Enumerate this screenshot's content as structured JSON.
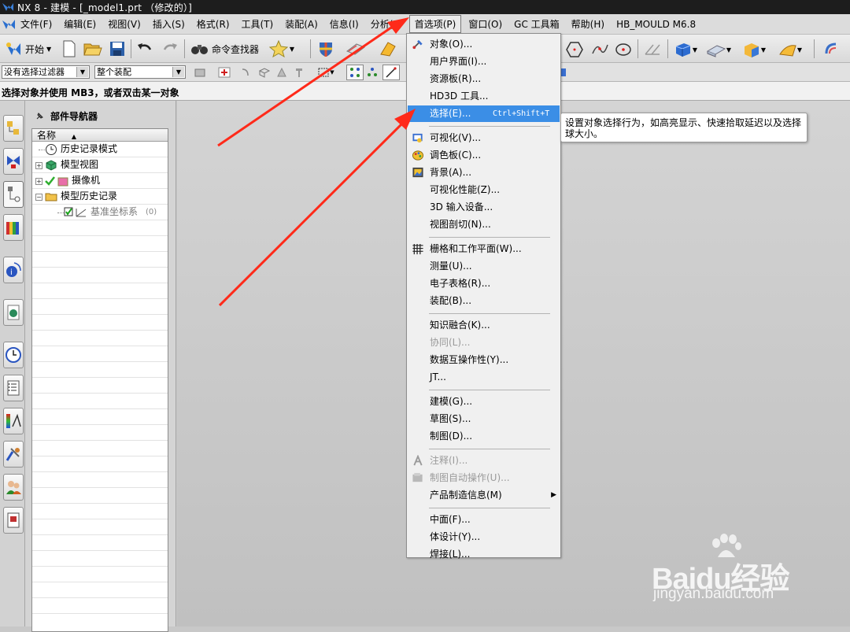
{
  "window": {
    "title": "NX 8 - 建模 - [_model1.prt （修改的）]"
  },
  "menubar": {
    "items": [
      "文件(F)",
      "编辑(E)",
      "视图(V)",
      "插入(S)",
      "格式(R)",
      "工具(T)",
      "装配(A)",
      "信息(I)",
      "分析(L)",
      "首选项(P)",
      "窗口(O)",
      "GC 工具箱",
      "帮助(H)",
      "HB_MOULD M6.8"
    ],
    "active_index": 9
  },
  "toolbar": {
    "start_label": "开始",
    "command_finder_label": "命令查找器"
  },
  "selection_bar": {
    "filter_value": "没有选择过滤器",
    "scope_value": "整个装配"
  },
  "status": {
    "prompt": "选择对象并使用 MB3，或者双击某一对象"
  },
  "navigator": {
    "title": "部件导航器",
    "column_header": "名称",
    "rows": [
      {
        "label": "历史记录模式",
        "icon": "clock-icon",
        "expander": "",
        "indent": 1
      },
      {
        "label": "模型视图",
        "icon": "model-views-icon",
        "expander": "+",
        "indent": 1
      },
      {
        "label": "摄像机",
        "icon": "camera-icon",
        "expander": "+",
        "indent": 1
      },
      {
        "label": "模型历史记录",
        "icon": "folder-icon",
        "expander": "-",
        "indent": 1
      },
      {
        "label": "基准坐标系",
        "icon": "datum-csys-icon",
        "expander": "",
        "indent": 2,
        "suffix": "(0)"
      }
    ]
  },
  "preferences_menu": {
    "items": [
      {
        "label": "对象(O)...",
        "icon": "object-icon"
      },
      {
        "label": "用户界面(I)...",
        "icon": ""
      },
      {
        "label": "资源板(R)...",
        "icon": ""
      },
      {
        "label": "HD3D 工具...",
        "icon": ""
      },
      {
        "label": "选择(E)...",
        "icon": "",
        "shortcut": "Ctrl+Shift+T",
        "highlighted": true
      },
      {
        "label": "可视化(V)...",
        "icon": "visualization-icon"
      },
      {
        "label": "调色板(C)...",
        "icon": "palette-icon"
      },
      {
        "label": "背景(A)...",
        "icon": "background-icon"
      },
      {
        "label": "可视化性能(Z)...",
        "icon": ""
      },
      {
        "label": "3D 输入设备...",
        "icon": ""
      },
      {
        "label": "视图剖切(N)...",
        "icon": ""
      },
      {
        "label": "栅格和工作平面(W)...",
        "icon": "grid-icon"
      },
      {
        "label": "测量(U)...",
        "icon": ""
      },
      {
        "label": "电子表格(R)...",
        "icon": ""
      },
      {
        "label": "装配(B)...",
        "icon": ""
      },
      {
        "label": "知识融合(K)...",
        "icon": ""
      },
      {
        "label": "协同(L)...",
        "icon": "",
        "disabled": true
      },
      {
        "label": "数据互操作性(Y)...",
        "icon": ""
      },
      {
        "label": "JT...",
        "icon": ""
      },
      {
        "label": "建模(G)...",
        "icon": ""
      },
      {
        "label": "草图(S)...",
        "icon": ""
      },
      {
        "label": "制图(D)...",
        "icon": ""
      },
      {
        "label": "注释(I)...",
        "icon": "annotation-icon",
        "disabled": true
      },
      {
        "label": "制图自动操作(U)...",
        "icon": "drafting-automation-icon",
        "disabled": true
      },
      {
        "label": "产品制造信息(M)",
        "icon": "",
        "submenu": true
      },
      {
        "label": "中面(F)...",
        "icon": ""
      },
      {
        "label": "体设计(Y)...",
        "icon": ""
      },
      {
        "label": "焊接(L)...",
        "icon": ""
      }
    ]
  },
  "tooltip": {
    "text": "设置对象选择行为，如高亮显示、快速拾取延迟以及选择球大小。"
  },
  "watermark": {
    "brand": "Baidu经验",
    "url": "jingyan.baidu.com"
  },
  "colors": {
    "highlight": "#3b8ee6",
    "arrow": "#ff2a1a",
    "titlebar": "#1d1d1d"
  }
}
